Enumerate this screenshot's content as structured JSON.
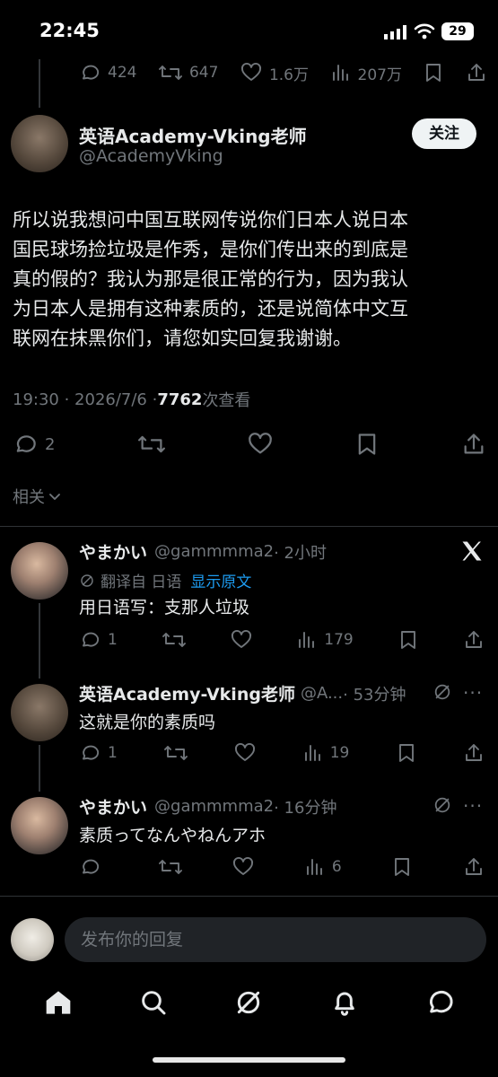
{
  "status_bar": {
    "time": "22:45",
    "battery": "29"
  },
  "prev_tweet_stats": {
    "replies": "424",
    "retweets": "647",
    "likes": "1.6万",
    "views": "207万"
  },
  "main_tweet": {
    "author_name": "英语Academy-Vking老师",
    "author_handle": "@AcademyVking",
    "follow_label": "关注",
    "text_lines": [
      "所以说我想问中国互联网传说你们日本人说日本",
      "国民球场捡垃圾是作秀，是你们传出来的到底是",
      "真的假的？我认为那是很正常的行为，因为我认",
      "为日本人是拥有这种素质的，还是说简体中文互",
      "联网在抹黑你们，请您如实回复我谢谢。"
    ],
    "timestamp": "19:30 · 2026/7/6 · ",
    "views_count": "7762",
    "views_label": " 次查看",
    "replies": "2",
    "related_label": "相关"
  },
  "replies": [
    {
      "name": "やまかい",
      "handle": "@gammmma2",
      "time": "· 2小时",
      "translate_label": "翻译自 日语",
      "show_original": "显示原文",
      "text": "用日语写：支那人垃圾",
      "replies": "1",
      "views": "179"
    },
    {
      "name": "英语Academy-Vking老师",
      "handle": "@A...",
      "time": "· 53分钟",
      "text": "这就是你的素质吗",
      "replies": "1",
      "views": "19"
    },
    {
      "name": "やまかい",
      "handle": "@gammmma2",
      "time": "· 16分钟",
      "text": "素质ってなんやねんアホ",
      "replies": "",
      "views": "6"
    }
  ],
  "composer": {
    "placeholder": "发布你的回复"
  },
  "icons": {
    "nav": [
      "home-icon",
      "search-icon",
      "grok-icon",
      "notifications-icon",
      "messages-icon"
    ]
  },
  "colors": {
    "background": "#000000",
    "text": "#e7e9ea",
    "muted": "#71767b",
    "link": "#1d9bf0"
  }
}
